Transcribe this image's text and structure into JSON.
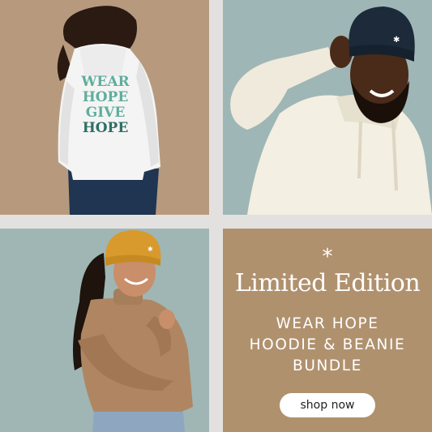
{
  "promo": {
    "star": "*",
    "headline": "Limited Edition",
    "line1": "WEAR HOPE",
    "line2": "HOODIE & BEANIE",
    "line3": "BUNDLE",
    "button_label": "shop now"
  },
  "hoodie_print": [
    "WEAR",
    "HOPE",
    "GIVE",
    "HOPE"
  ],
  "colors": {
    "promo_bg": "#b0916e",
    "hoodie_teal": "#5fae9c",
    "beanie_navy": "#1c2a3a",
    "beanie_mustard": "#d89a2c"
  }
}
